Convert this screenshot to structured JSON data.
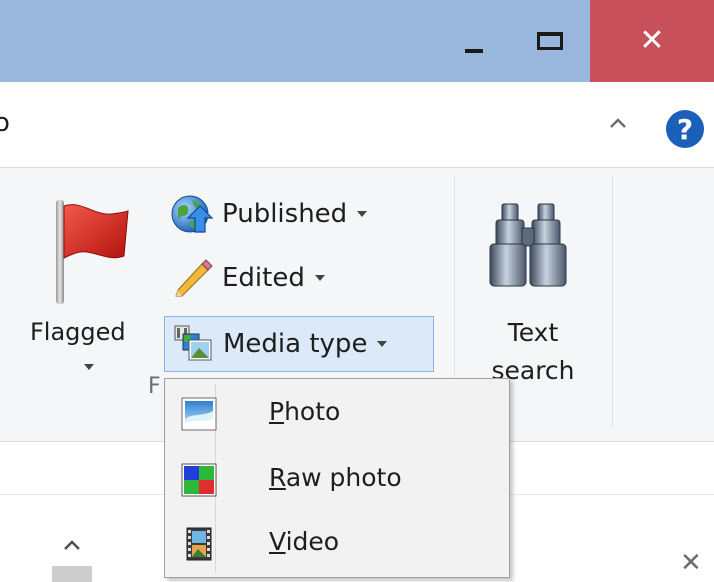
{
  "window": {
    "tab_fragment": "o",
    "group_fragment": "F",
    "close_glyph": "✕",
    "pane_close_glyph": "✕"
  },
  "ribbon": {
    "flagged_label": "Flagged",
    "published_label": "Published",
    "edited_label": "Edited",
    "media_type_label": "Media type",
    "text_search_line1": "Text",
    "text_search_line2": "search"
  },
  "help": {
    "glyph": "?"
  },
  "media_menu": {
    "items": [
      {
        "accel": "P",
        "rest": "hoto"
      },
      {
        "accel": "R",
        "rest": "aw photo"
      },
      {
        "accel": "V",
        "rest": "ideo"
      }
    ]
  },
  "colors": {
    "titlebar": "#99b6dc",
    "close_button": "#c7505a",
    "ribbon_bg": "#f5f6f7",
    "hover_bg": "#dbe9f8",
    "hover_border": "#8db2e3"
  }
}
